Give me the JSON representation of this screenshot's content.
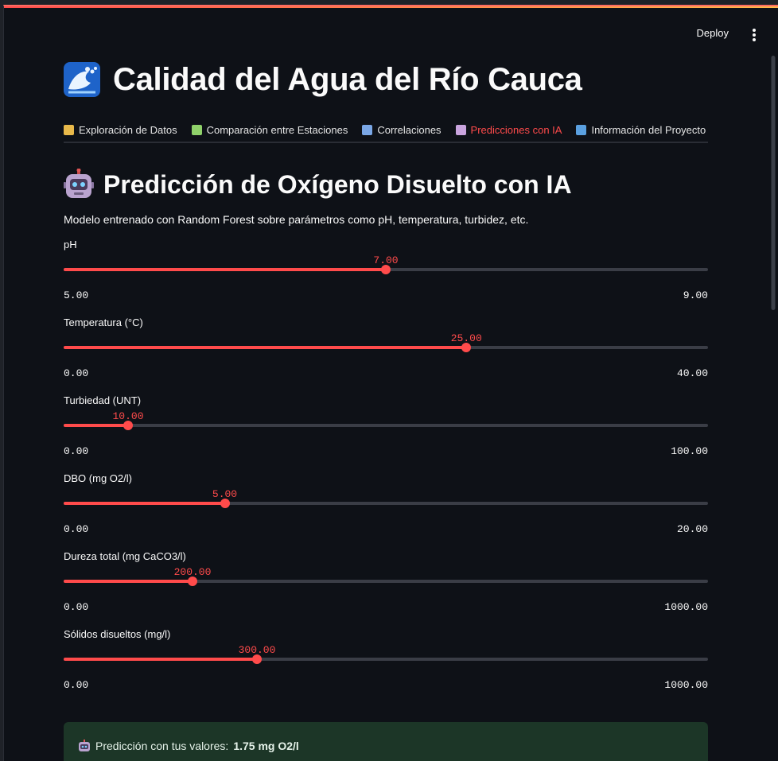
{
  "header": {
    "deploy_label": "Deploy"
  },
  "app": {
    "title": "Calidad del Agua del Río Cauca"
  },
  "tabs": [
    {
      "label": "Exploración de Datos",
      "active": false,
      "icon": "bar-chart-icon",
      "color": "#e8b94a"
    },
    {
      "label": "Comparación entre Estaciones",
      "active": false,
      "icon": "test-tube-icon",
      "color": "#8fd16a"
    },
    {
      "label": "Correlaciones",
      "active": false,
      "icon": "magnifier-icon",
      "color": "#7aa7e6"
    },
    {
      "label": "Predicciones con IA",
      "active": true,
      "icon": "robot-icon",
      "color": "#c9a4de"
    },
    {
      "label": "Información del Proyecto",
      "active": false,
      "icon": "book-icon",
      "color": "#5aa0e0"
    }
  ],
  "section": {
    "title": "Predicción de Oxígeno Disuelto con IA",
    "description": "Modelo entrenado con Random Forest sobre parámetros como pH, temperatura, turbidez, etc."
  },
  "sliders": [
    {
      "label": "pH",
      "value": 7.0,
      "value_text": "7.00",
      "min_text": "5.00",
      "max_text": "9.00",
      "min": 5,
      "max": 9
    },
    {
      "label": "Temperatura (°C)",
      "value": 25,
      "value_text": "25.00",
      "min_text": "0.00",
      "max_text": "40.00",
      "min": 0,
      "max": 40
    },
    {
      "label": "Turbiedad (UNT)",
      "value": 10,
      "value_text": "10.00",
      "min_text": "0.00",
      "max_text": "100.00",
      "min": 0,
      "max": 100
    },
    {
      "label": "DBO (mg O2/l)",
      "value": 5,
      "value_text": "5.00",
      "min_text": "0.00",
      "max_text": "20.00",
      "min": 0,
      "max": 20
    },
    {
      "label": "Dureza total (mg CaCO3/l)",
      "value": 200,
      "value_text": "200.00",
      "min_text": "0.00",
      "max_text": "1000.00",
      "min": 0,
      "max": 1000
    },
    {
      "label": "Sólidos disueltos (mg/l)",
      "value": 300,
      "value_text": "300.00",
      "min_text": "0.00",
      "max_text": "1000.00",
      "min": 0,
      "max": 1000
    }
  ],
  "result": {
    "prefix": "Predicción con tus valores:",
    "value": "1.75 mg O2/l"
  },
  "colors": {
    "accent": "#ff4b4b",
    "background": "#0e1117",
    "success_bg": "#1c3627"
  }
}
